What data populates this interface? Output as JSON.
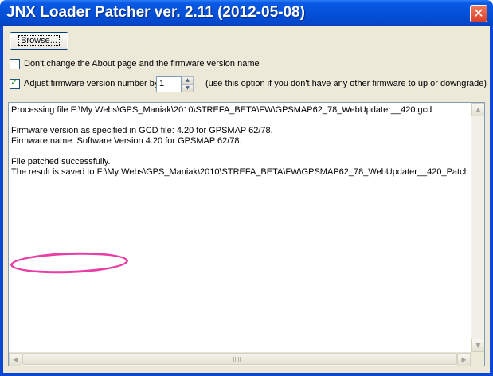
{
  "window": {
    "title": "JNX Loader Patcher ver. 2.11 (2012-05-08)",
    "close_symbol": "✕"
  },
  "controls": {
    "browse_label": "Browse...",
    "checkbox_about_label": "Don't change the About page and the firmware version name",
    "checkbox_about_checked": false,
    "checkbox_adjust_label": "Adjust firmware version number by",
    "checkbox_adjust_checked": true,
    "adjust_value": "1",
    "adjust_hint": "(use this option if you don't have any other firmware to up or downgrade)"
  },
  "log": {
    "lines": [
      "Processing file F:\\My Webs\\GPS_Maniak\\2010\\STREFA_BETA\\FW\\GPSMAP62_78_WebUpdater__420.gcd",
      "",
      "Firmware version as specified in GCD file: 4.20 for GPSMAP 62/78.",
      "Firmware name: Software Version 4.20 for GPSMAP 62/78.",
      "",
      "File patched successfully.",
      "The result is saved to F:\\My Webs\\GPS_Maniak\\2010\\STREFA_BETA\\FW\\GPSMAP62_78_WebUpdater__420_Patch"
    ]
  },
  "icons": {
    "scroll_up": "▲",
    "scroll_down": "▼",
    "scroll_left": "◀",
    "scroll_right": "▶",
    "spin_up": "▲",
    "spin_down": "▼"
  },
  "colors": {
    "titlebar": "#0450d8",
    "annotation": "#e83fa7"
  }
}
